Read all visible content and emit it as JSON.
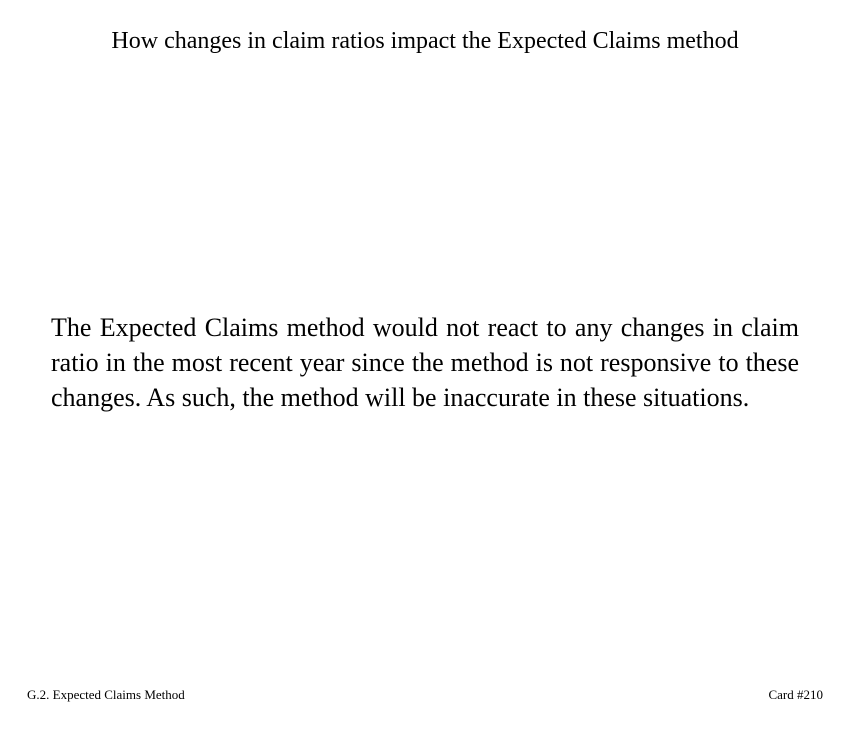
{
  "card": {
    "title": "How changes in claim ratios impact the Expected Claims method",
    "body": "The Expected Claims method would not react to any changes in claim ratio in the most recent year since the method is not responsive to these changes.  As such, the method will be inaccurate in these situations.",
    "section": "G.2. Expected Claims Method",
    "card_number": "Card #210"
  }
}
